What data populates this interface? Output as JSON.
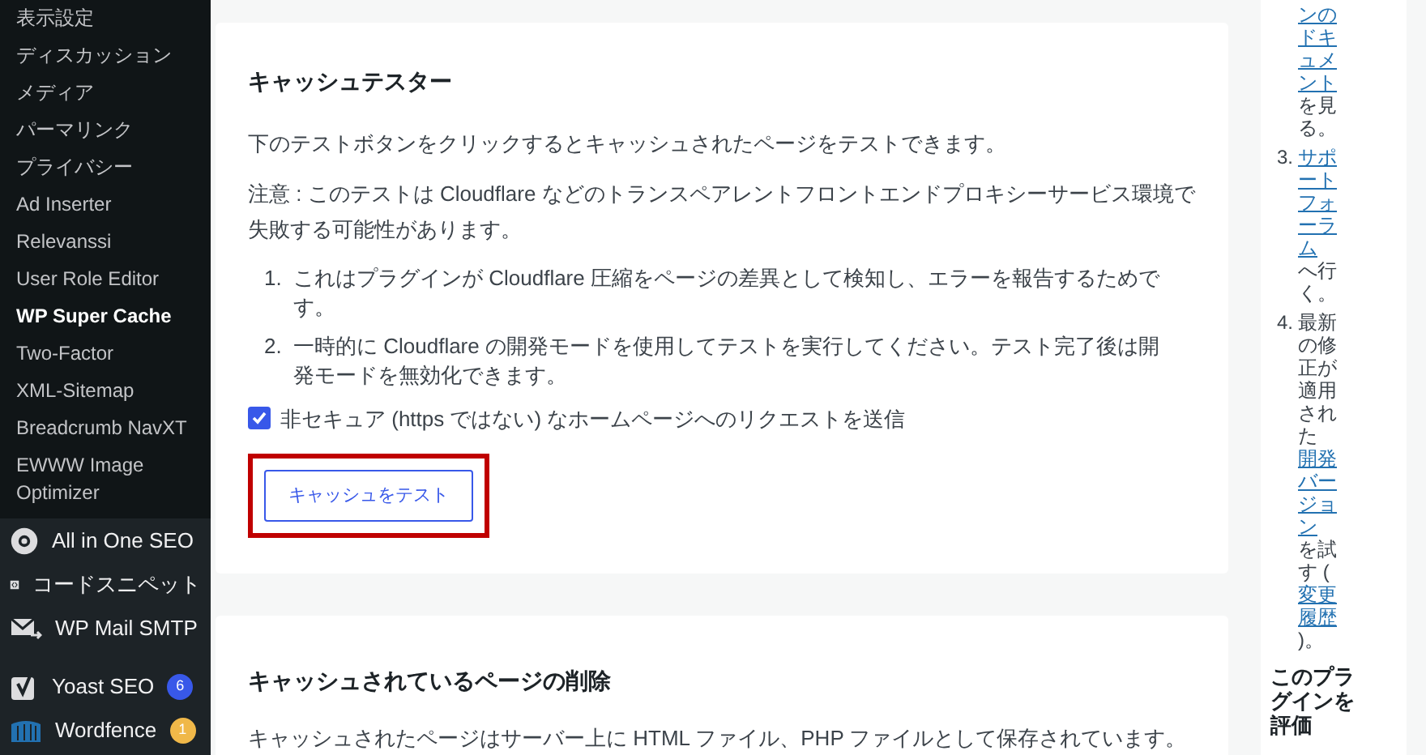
{
  "sidebar": {
    "submenu": [
      {
        "label": "表示設定",
        "selected": false
      },
      {
        "label": "ディスカッション",
        "selected": false
      },
      {
        "label": "メディア",
        "selected": false
      },
      {
        "label": "パーマリンク",
        "selected": false
      },
      {
        "label": "プライバシー",
        "selected": false
      },
      {
        "label": "Ad Inserter",
        "selected": false
      },
      {
        "label": "Relevanssi",
        "selected": false
      },
      {
        "label": "User Role Editor",
        "selected": false
      },
      {
        "label": "WP Super Cache",
        "selected": true
      },
      {
        "label": "Two-Factor",
        "selected": false
      },
      {
        "label": "XML-Sitemap",
        "selected": false
      },
      {
        "label": "Breadcrumb NavXT",
        "selected": false
      },
      {
        "label": "EWWW Image Optimizer",
        "selected": false
      }
    ],
    "menu": [
      {
        "label": "All in One SEO",
        "kind": "gear"
      },
      {
        "label": "コードスニペット",
        "kind": "code"
      },
      {
        "label": "WP Mail SMTP",
        "kind": "mail"
      },
      {
        "label": "Yoast SEO",
        "kind": "yoast",
        "badge": "6",
        "color": "#3858e9"
      },
      {
        "label": "Wordfence",
        "kind": "wordfence",
        "badge": "1",
        "color": "#f0b849"
      }
    ]
  },
  "cache_tester": {
    "title": "キャッシュテスター",
    "intro": "下のテストボタンをクリックするとキャッシュされたページをテストできます。",
    "note": "注意 : このテストは Cloudflare などのトランスペアレントフロントエンドプロキシーサービス環境で失敗する可能性があります。",
    "steps": [
      {
        "number": "1.",
        "text": "これはプラグインが Cloudflare 圧縮をページの差異として検知し、エラーを報告するためです。"
      },
      {
        "number": "2.",
        "text": "一時的に Cloudflare の開発モードを使用してテストを実行してください。テスト完了後は開発モードを無効化できます。"
      }
    ],
    "checkbox": {
      "label": "非セキュア (https ではない) なホームページへのリクエストを送信",
      "checked": true
    },
    "button": "キャッシュをテスト",
    "highlighted": true
  },
  "delete_cache": {
    "title": "キャッシュされているページの削除",
    "text": "キャッシュされたページはサーバー上に HTML ファイル、PHP ファイルとして保存されています。"
  },
  "help": {
    "items": [
      {
        "parts": [
          {
            "text": "ンのドキュメント",
            "link": true
          },
          {
            "text": "を見る。",
            "link": false
          }
        ]
      },
      {
        "number": "3.",
        "parts": [
          {
            "text": "サポートフォーラム",
            "link": true
          },
          {
            "text": "へ行く。",
            "link": false
          }
        ]
      },
      {
        "number": "4.",
        "parts": [
          {
            "text": "最新の修正が適用された",
            "link": false
          },
          {
            "text": "開発バージョン",
            "link": true
          },
          {
            "text": "を試す (",
            "link": false
          },
          {
            "text": "変更履歴",
            "link": true
          },
          {
            "text": ")。",
            "link": false
          }
        ]
      }
    ],
    "rate_title": "このプラグインを評価"
  }
}
